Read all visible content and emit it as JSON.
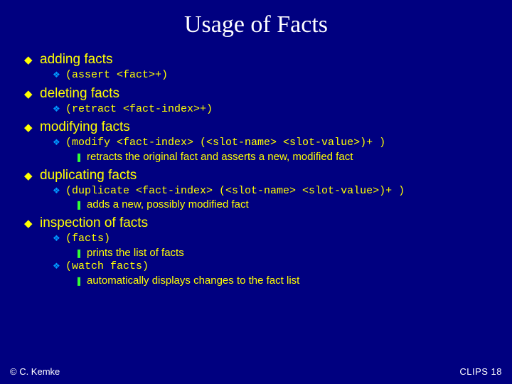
{
  "title": "Usage of Facts",
  "sections": [
    {
      "heading": "adding facts",
      "items": [
        {
          "code": "(assert <fact>+)"
        }
      ]
    },
    {
      "heading": "deleting facts",
      "items": [
        {
          "code": "(retract  <fact-index>+)"
        }
      ]
    },
    {
      "heading": "modifying facts",
      "items": [
        {
          "code": "(modify <fact-index> (<slot-name> <slot-value>)+ )",
          "subs": [
            "retracts the original fact and asserts a new, modified fact"
          ]
        }
      ]
    },
    {
      "heading": "duplicating facts",
      "items": [
        {
          "code": "(duplicate <fact-index> (<slot-name> <slot-value>)+ )",
          "subs": [
            "adds a new, possibly modified fact"
          ]
        }
      ]
    },
    {
      "heading": "inspection of facts",
      "items": [
        {
          "code": "(facts)",
          "subs": [
            "prints the list of facts"
          ]
        },
        {
          "code": "(watch facts)",
          "subs": [
            "automatically displays changes to the fact list"
          ]
        }
      ]
    }
  ],
  "footer": {
    "left": "© C. Kemke",
    "right": "CLIPS  18"
  },
  "glyphs": {
    "l1": "◆",
    "l2": "❖",
    "l3": "❚"
  }
}
